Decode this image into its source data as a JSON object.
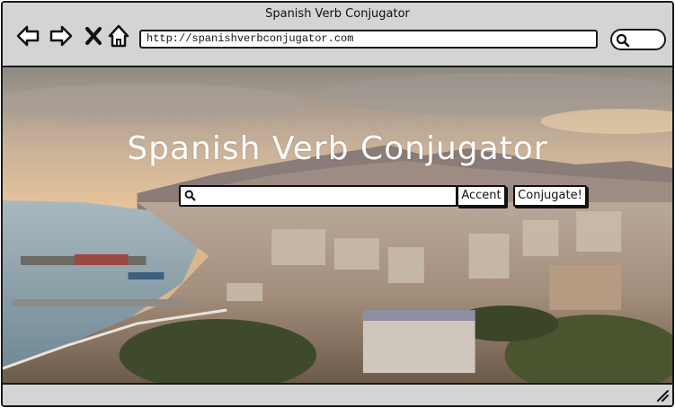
{
  "window": {
    "title": "Spanish Verb Conjugator"
  },
  "toolbar": {
    "url": "http://spanishverbconjugator.com",
    "back_icon": "arrow-left-icon",
    "forward_icon": "arrow-right-icon",
    "close_icon": "close-icon",
    "home_icon": "home-icon",
    "search_icon": "search-icon"
  },
  "hero": {
    "title": "Spanish Verb Conjugator",
    "background": "city-coastline-photo"
  },
  "search": {
    "input_value": "",
    "accent_label": "Accent",
    "conjugate_label": "Conjugate!"
  },
  "colors": {
    "chrome": "#d4d4d4",
    "outline": "#1a1a1a",
    "title_text": "#ffffff"
  }
}
